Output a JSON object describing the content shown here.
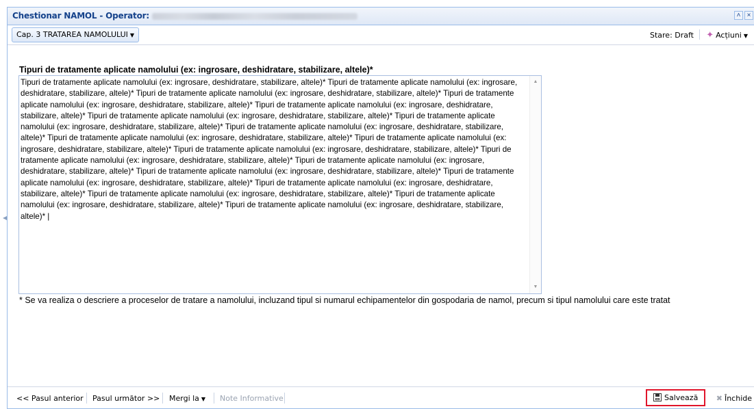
{
  "window": {
    "title": "Chestionar NAMOL - Operator:",
    "collapse_icon": "double-chevron-up-icon",
    "close_icon": "close-icon"
  },
  "toolbar": {
    "chapter_label": "Cap. 3 TRATAREA NAMOLULUI",
    "status_text": "Stare: Draft",
    "actions_label": "Acțiuni",
    "actions_icon": "gear-sparkle-icon"
  },
  "form": {
    "field_label": "Tipuri de tratamente aplicate namolului (ex: ingrosare, deshidratare, stabilizare, altele)*",
    "field_value": "Tipuri de tratamente aplicate namolului (ex: ingrosare, deshidratare, stabilizare, altele)* Tipuri de tratamente aplicate namolului (ex: ingrosare, deshidratare, stabilizare, altele)* Tipuri de tratamente aplicate namolului (ex: ingrosare, deshidratare, stabilizare, altele)* Tipuri de tratamente aplicate namolului (ex: ingrosare, deshidratare, stabilizare, altele)* Tipuri de tratamente aplicate namolului (ex: ingrosare, deshidratare, stabilizare, altele)* Tipuri de tratamente aplicate namolului (ex: ingrosare, deshidratare, stabilizare, altele)* Tipuri de tratamente aplicate namolului (ex: ingrosare, deshidratare, stabilizare, altele)* Tipuri de tratamente aplicate namolului (ex: ingrosare, deshidratare, stabilizare, altele)* Tipuri de tratamente aplicate namolului (ex: ingrosare, deshidratare, stabilizare, altele)* Tipuri de tratamente aplicate namolului (ex: ingrosare, deshidratare, stabilizare, altele)* Tipuri de tratamente aplicate namolului (ex: ingrosare, deshidratare, stabilizare, altele)* Tipuri de tratamente aplicate namolului (ex: ingrosare, deshidratare, stabilizare, altele)* Tipuri de tratamente aplicate namolului (ex: ingrosare, deshidratare, stabilizare, altele)* Tipuri de tratamente aplicate namolului (ex: ingrosare, deshidratare, stabilizare, altele)* Tipuri de tratamente aplicate namolului (ex: ingrosare, deshidratare, stabilizare, altele)* Tipuri de tratamente aplicate namolului (ex: ingrosare, deshidratare, stabilizare, altele)* Tipuri de tratamente aplicate namolului (ex: ingrosare, deshidratare, stabilizare, altele)* Tipuri de tratamente aplicate namolului (ex: ingrosare, deshidratare, stabilizare, altele)* Tipuri de tratamente aplicate namolului (ex: ingrosare, deshidratare, stabilizare, altele)* |",
    "note": "* Se va realiza o descriere a proceselor de tratare a namolului, incluzand tipul si numarul echipamentelor din gospodaria de namol, precum si tipul namolului care este tratat"
  },
  "footer": {
    "prev_label": "<< Pasul anterior",
    "next_label": "Pasul următor >>",
    "goto_label": "Mergi la",
    "info_label": "Note Informative",
    "save_label": "Salvează",
    "close_label": "Închide"
  }
}
